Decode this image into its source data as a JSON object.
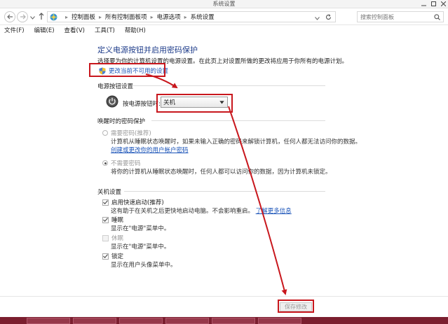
{
  "window": {
    "title": "系统设置"
  },
  "address": {
    "crumbs": [
      "控制面板",
      "所有控制面板项",
      "电源选项",
      "系统设置"
    ],
    "search_placeholder": "搜索控制面板"
  },
  "menu": {
    "items": [
      "文件(F)",
      "编辑(E)",
      "查看(V)",
      "工具(T)",
      "帮助(H)"
    ]
  },
  "content": {
    "title": "定义电源按钮并启用密码保护",
    "intro": "选择要为你的计算机设置的电源设置。在此页上对设置所做的更改将应用于你所有的电源计划。",
    "change_link": "更改当前不可用的设置",
    "power_section": {
      "title": "电源按钮设置",
      "label": "按电源按钮时:",
      "selected": "关机"
    },
    "password_section": {
      "title": "唤醒时的密码保护",
      "require_label": "需要密码(推荐)",
      "require_desc": "计算机从睡眠状态唤醒时，如果未输入正确的密码来解锁计算机，任何人都无法访问你的数据。",
      "create_link": "创建或更改你的用户帐户密码",
      "norequire_label": "不需要密码",
      "norequire_desc": "将你的计算机从睡眠状态唤醒时，任何人都可以访问你的数据，因为计算机未锁定。"
    },
    "shutdown_section": {
      "title": "关机设置",
      "fast_label": "启用快速启动(推荐)",
      "fast_desc": "这有助于在关机之后更快地启动电脑。不会影响重启。",
      "fast_link": "了解更多信息",
      "sleep_label": "睡眠",
      "sleep_desc": "显示在\"电源\"菜单中。",
      "hibernate_label": "休眠",
      "hibernate_desc": "显示在\"电源\"菜单中。",
      "lock_label": "锁定",
      "lock_desc": "显示在用户头像菜单中。"
    },
    "save_label": "保存修改"
  },
  "colors": {
    "title_blue": "#1e3c8a",
    "link_blue": "#1a53b8",
    "annotation_red": "#c8171d",
    "taskbar": "#7b1f2f"
  },
  "icons": {
    "change_link": "shield-icon",
    "power": "power-icon",
    "home": "control-panel-icon"
  }
}
